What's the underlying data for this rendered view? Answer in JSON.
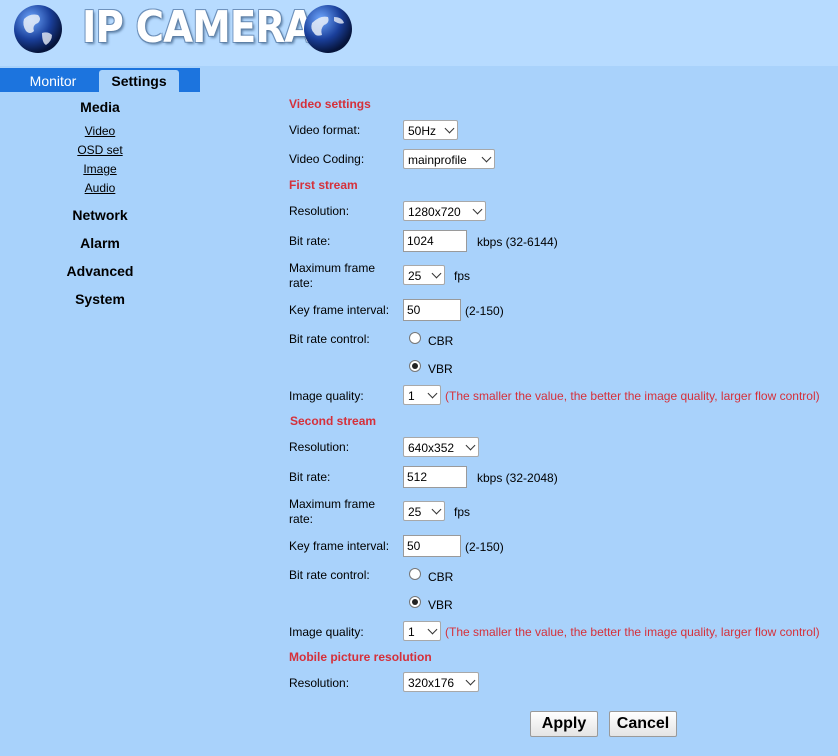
{
  "header": {
    "title": "IP CAMERA"
  },
  "tabs": {
    "monitor": "Monitor",
    "settings": "Settings"
  },
  "sidebar": {
    "media": "Media",
    "media_items": [
      "Video",
      "OSD set",
      "Image",
      "Audio"
    ],
    "network": "Network",
    "alarm": "Alarm",
    "advanced": "Advanced",
    "system": "System"
  },
  "video_settings": {
    "title": "Video settings",
    "format_label": "Video format:",
    "format_value": "50Hz",
    "coding_label": "Video Coding:",
    "coding_value": "mainprofile"
  },
  "first_stream": {
    "title": "First stream",
    "resolution_label": "Resolution:",
    "resolution_value": "1280x720",
    "bitrate_label": "Bit rate:",
    "bitrate_value": "1024",
    "bitrate_unit": "kbps (32-6144)",
    "framerate_label_1": "Maximum frame",
    "framerate_label_2": "rate:",
    "framerate_value": "25",
    "framerate_unit": "fps",
    "keyframe_label": "Key frame interval:",
    "keyframe_value": "50",
    "keyframe_range": "(2-150)",
    "control_label": "Bit rate control:",
    "cbr": "CBR",
    "vbr": "VBR",
    "quality_label": "Image quality:",
    "quality_value": "1",
    "quality_hint": "(The smaller the value, the better the image quality, larger flow control)"
  },
  "second_stream": {
    "title": "Second stream",
    "resolution_label": "Resolution:",
    "resolution_value": "640x352",
    "bitrate_label": "Bit rate:",
    "bitrate_value": "512",
    "bitrate_unit": "kbps (32-2048)",
    "framerate_label_1": "Maximum frame",
    "framerate_label_2": "rate:",
    "framerate_value": "25",
    "framerate_unit": "fps",
    "keyframe_label": "Key frame interval:",
    "keyframe_value": "50",
    "keyframe_range": "(2-150)",
    "control_label": "Bit rate control:",
    "cbr": "CBR",
    "vbr": "VBR",
    "quality_label": "Image quality:",
    "quality_value": "1",
    "quality_hint": "(The smaller the value, the better the image quality, larger flow control)"
  },
  "mobile": {
    "title": "Mobile picture resolution",
    "resolution_label": "Resolution:",
    "resolution_value": "320x176"
  },
  "buttons": {
    "apply": "Apply",
    "cancel": "Cancel"
  }
}
